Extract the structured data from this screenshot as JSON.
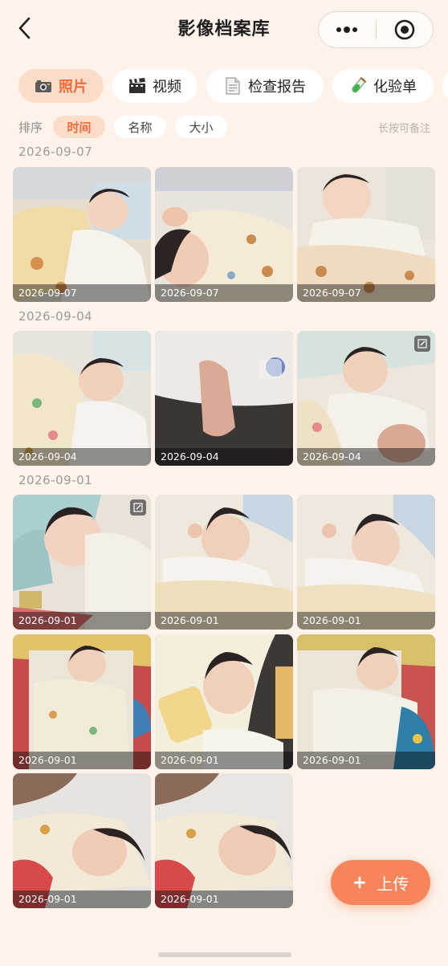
{
  "header": {
    "title": "影像档案库"
  },
  "tabs": [
    {
      "label": "照片",
      "icon": "camera-icon",
      "active": true
    },
    {
      "label": "视频",
      "icon": "clapper-icon",
      "active": false
    },
    {
      "label": "检查报告",
      "icon": "document-icon",
      "active": false
    },
    {
      "label": "化验单",
      "icon": "test-tube-icon",
      "active": false
    }
  ],
  "sort": {
    "label": "排序",
    "options": [
      "时间",
      "名称",
      "大小"
    ],
    "selected": "时间",
    "hint": "长按可备注"
  },
  "groups": [
    {
      "date": "2026-09-07",
      "photos": [
        {
          "caption": "2026-09-07",
          "edited": false
        },
        {
          "caption": "2026-09-07",
          "edited": false
        },
        {
          "caption": "2026-09-07",
          "edited": false
        }
      ]
    },
    {
      "date": "2026-09-04",
      "photos": [
        {
          "caption": "2026-09-04",
          "edited": false
        },
        {
          "caption": "2026-09-04",
          "edited": false
        },
        {
          "caption": "2026-09-04",
          "edited": true
        }
      ]
    },
    {
      "date": "2026-09-01",
      "photos": [
        {
          "caption": "2026-09-01",
          "edited": true
        },
        {
          "caption": "2026-09-01",
          "edited": false
        },
        {
          "caption": "2026-09-01",
          "edited": false
        },
        {
          "caption": "2026-09-01",
          "edited": false
        },
        {
          "caption": "2026-09-01",
          "edited": false
        },
        {
          "caption": "2026-09-01",
          "edited": false
        },
        {
          "caption": "2026-09-01",
          "edited": false
        },
        {
          "caption": "2026-09-01",
          "edited": false
        }
      ]
    }
  ],
  "fab": {
    "plus": "+",
    "label": "上传"
  },
  "colors": {
    "accent": "#f06a3a",
    "accent_bg": "#fbdcc8",
    "background": "#fdf3ea",
    "fab": "#f7845a"
  }
}
